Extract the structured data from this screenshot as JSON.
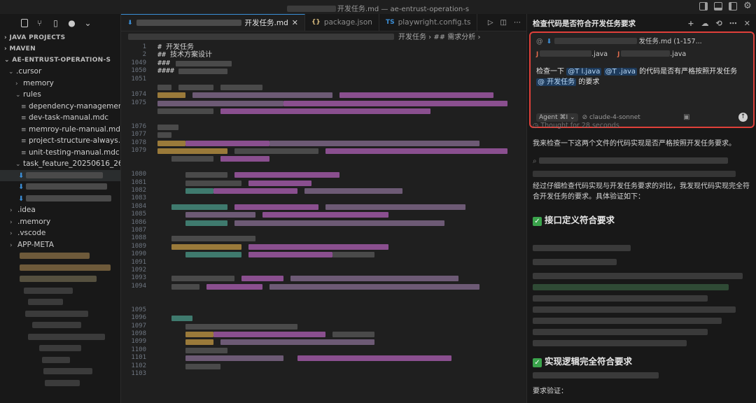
{
  "window": {
    "title_suffix": "开发任务.md — ae-entrust-operation-s"
  },
  "sidebar": {
    "sections": [
      "JAVA PROJECTS",
      "MAVEN",
      "AE-ENTRUST-OPERATION-S"
    ],
    "tree": [
      {
        "label": ".cursor",
        "chev": "⌄",
        "indent": 1
      },
      {
        "label": "memory",
        "chev": "›",
        "indent": 2
      },
      {
        "label": "rules",
        "chev": "⌄",
        "indent": 2
      },
      {
        "label": "dependency-management...",
        "icon": "≡",
        "indent": 3
      },
      {
        "label": "dev-task-manual.mdc",
        "icon": "≡",
        "indent": 3
      },
      {
        "label": "memroy-rule-manual.mdc",
        "icon": "≡",
        "indent": 3
      },
      {
        "label": "project-structure-always...",
        "icon": "≡",
        "indent": 3
      },
      {
        "label": "unit-testing-manual.mdc",
        "icon": "≡",
        "indent": 3
      },
      {
        "label": "task_feature_20250616_26...",
        "chev": "⌄",
        "indent": 2
      }
    ],
    "tree_after": [
      {
        "label": ".idea",
        "chev": "›"
      },
      {
        "label": ".memory",
        "chev": "›"
      },
      {
        "label": ".vscode",
        "chev": "›"
      },
      {
        "label": "APP-META",
        "chev": "›"
      }
    ]
  },
  "editor": {
    "tabs": [
      {
        "label": "开发任务.md",
        "icon": "⬇",
        "active": true
      },
      {
        "label": "package.json",
        "icon": "{}",
        "active": false
      },
      {
        "label": "playwright.config.ts",
        "icon": "TS",
        "active": false
      }
    ],
    "breadcrumb": "开发任务 › ## 需求分析 ›",
    "line_numbers": [
      "1",
      "2",
      "1049",
      "1050",
      "1051",
      "",
      "1074",
      "1075",
      "",
      "",
      "1076",
      "1077",
      "1078",
      "1079",
      "",
      "",
      "1080",
      "1081",
      "1082",
      "1083",
      "1084",
      "1085",
      "1086",
      "1087",
      "1088",
      "1089",
      "1090",
      "1091",
      "1092",
      "1093",
      "1094",
      "",
      "",
      "1095",
      "1096",
      "1097",
      "1098",
      "1099",
      "1100",
      "1101",
      "1102",
      "1103"
    ],
    "text_lines": [
      "#                          开发任务",
      "## 技术方案设计",
      "###",
      "####"
    ]
  },
  "chat": {
    "title": "检查代码是否符合开发任务要求",
    "context_file": "发任务.md (1-157...",
    "file_1": ".java",
    "file_2": ".java",
    "prompt_a": "检查一下 ",
    "mention_1": "@T                    l.java",
    "mention_2": "@T                    .java",
    "prompt_b": " 的代码是否有严格按照开发任务 ",
    "mention_3": "@                         开发任务",
    "prompt_c": " 的要求",
    "agent_label": "Agent ⌘I ⌄",
    "model": "claude-4-sonnet",
    "thought": "Thought for 28 seconds",
    "intro": "我来检查一下这两个文件的代码实现是否严格按照开发任务要求。",
    "summary": "经过仔细检查代码实现与开发任务要求的对比，我发现代码实现完全符合开发任务的要求。具体验证如下：",
    "heading_1": "接口定义符合要求",
    "heading_2": "实现逻辑完全符合要求",
    "verify_label": "要求验证："
  },
  "colors": {
    "accent": "#3b8fd8",
    "highlight_border": "#e0403a",
    "check_green": "#3aa34b"
  }
}
